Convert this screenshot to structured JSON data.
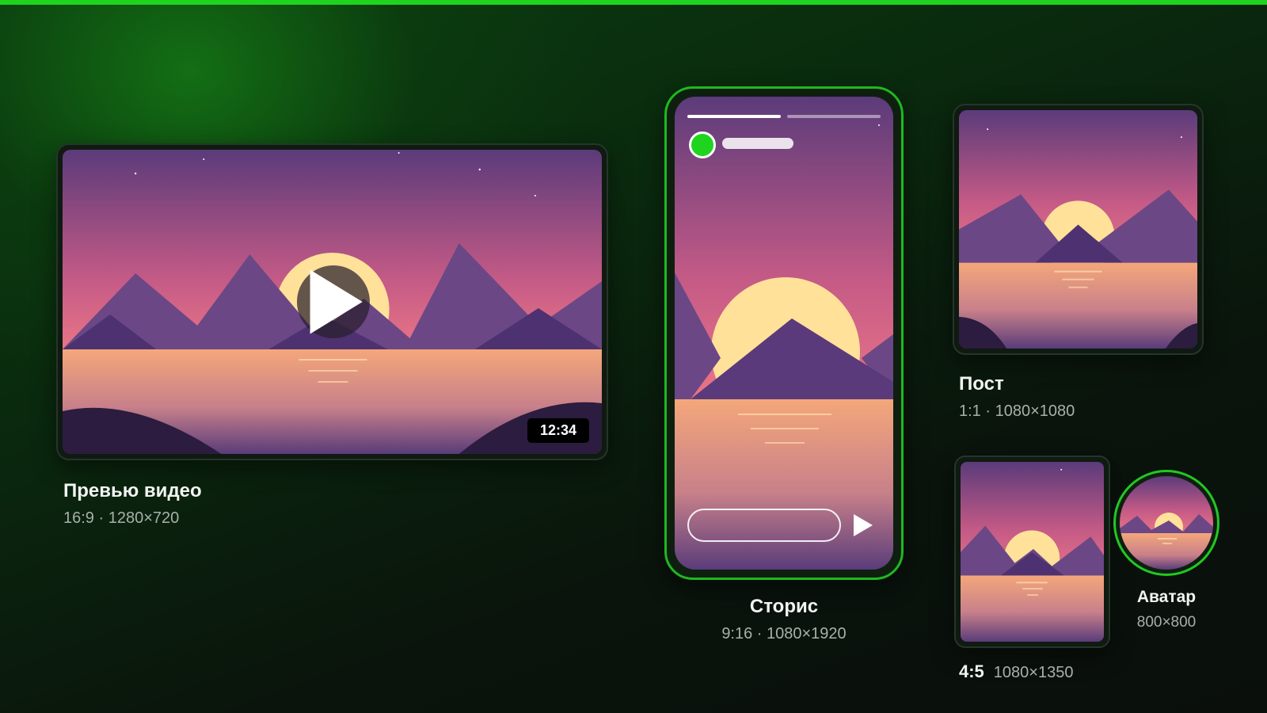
{
  "colors": {
    "accent": "#1fd41f",
    "sky_top": "#5b3b7a",
    "sky_bottom": "#e56f86",
    "sun": "#ffe19a",
    "mountain": "#6b4785",
    "mountain_dark": "#4e3170",
    "water_top": "#f4a77a",
    "water_bottom": "#5a3c7a"
  },
  "formats": {
    "video": {
      "title": "Превью видео",
      "spec": "16:9 · 1280×720",
      "duration": "12:34"
    },
    "story": {
      "title": "Сторис",
      "spec": "9:16 · 1080×1920",
      "progress_segments": 2,
      "active_segment": 1
    },
    "post": {
      "title": "Пост",
      "spec": "1:1 · 1080×1080"
    },
    "portrait": {
      "ratio": "4:5",
      "spec": "1080×1350"
    },
    "avatar": {
      "title": "Аватар",
      "spec": "800×800"
    }
  },
  "icons": {
    "play": "play-icon",
    "send": "send-icon"
  }
}
